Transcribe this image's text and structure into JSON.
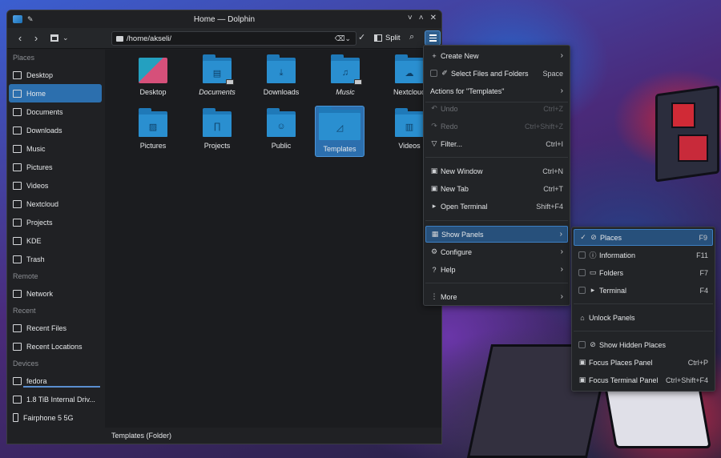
{
  "window": {
    "title": "Home — Dolphin",
    "buttons": [
      "˅",
      "˄",
      "✕"
    ]
  },
  "toolbar": {
    "back_icon": "‹",
    "forward_icon": "›",
    "path": "/home/akseli/",
    "split_label": "Split"
  },
  "sidebar": {
    "sections": [
      {
        "title": "Places",
        "items": [
          "Desktop",
          "Home",
          "Documents",
          "Downloads",
          "Music",
          "Pictures",
          "Videos",
          "Nextcloud",
          "Projects",
          "KDE",
          "Trash"
        ]
      },
      {
        "title": "Remote",
        "items": [
          "Network"
        ]
      },
      {
        "title": "Recent",
        "items": [
          "Recent Files",
          "Recent Locations"
        ]
      },
      {
        "title": "Devices",
        "items": [
          "fedora",
          "1.8 TiB Internal Driv...",
          "Fairphone 5 5G"
        ]
      }
    ],
    "active_item": "Home"
  },
  "files": [
    {
      "name": "Desktop",
      "italic": false
    },
    {
      "name": "Documents",
      "italic": true
    },
    {
      "name": "Downloads",
      "italic": false
    },
    {
      "name": "Music",
      "italic": true
    },
    {
      "name": "Nextcloud",
      "italic": false
    },
    {
      "name": "Pictures",
      "italic": false
    },
    {
      "name": "Projects",
      "italic": false
    },
    {
      "name": "Public",
      "italic": false
    },
    {
      "name": "Templates",
      "italic": false,
      "selected": true
    },
    {
      "name": "Videos",
      "italic": false
    }
  ],
  "statusbar": {
    "text": "Templates (Folder)"
  },
  "main_menu": {
    "items": [
      {
        "label": "Create New",
        "icon": "+",
        "arrow": true
      },
      {
        "label": "Select Files and Folders",
        "icon": "✐",
        "shortcut": "Space",
        "check": true
      },
      {
        "label": "Actions for \"Templates\"",
        "arrow": true
      },
      {
        "label": "Undo",
        "icon": "↶",
        "shortcut": "Ctrl+Z",
        "disabled": true
      },
      {
        "label": "Redo",
        "icon": "↷",
        "shortcut": "Ctrl+Shift+Z",
        "disabled": true
      },
      {
        "label": "Filter...",
        "icon": "▽",
        "shortcut": "Ctrl+I"
      },
      {
        "label": "New Window",
        "icon": "▣",
        "shortcut": "Ctrl+N"
      },
      {
        "label": "New Tab",
        "icon": "▣",
        "shortcut": "Ctrl+T"
      },
      {
        "label": "Open Terminal",
        "icon": "▸",
        "shortcut": "Shift+F4"
      },
      {
        "label": "Show Panels",
        "icon": "▦",
        "arrow": true,
        "highlighted": true
      },
      {
        "label": "Configure",
        "icon": "⚙",
        "arrow": true
      },
      {
        "label": "Help",
        "icon": "?",
        "arrow": true
      },
      {
        "label": "More",
        "icon": "⋮",
        "arrow": true
      }
    ]
  },
  "panels_menu": {
    "items": [
      {
        "label": "Places",
        "icon": "✓",
        "shortcut": "F9",
        "highlighted": true
      },
      {
        "label": "Information",
        "shortcut": "F11",
        "check": true
      },
      {
        "label": "Folders",
        "shortcut": "F7",
        "check": true
      },
      {
        "label": "Terminal",
        "shortcut": "F4",
        "check": true
      },
      {
        "label": "Unlock Panels",
        "icon": "🔒"
      },
      {
        "label": "Show Hidden Places",
        "check": true
      },
      {
        "label": "Focus Places Panel",
        "shortcut": "Ctrl+P"
      },
      {
        "label": "Focus Terminal Panel",
        "shortcut": "Ctrl+Shift+F4"
      }
    ]
  }
}
